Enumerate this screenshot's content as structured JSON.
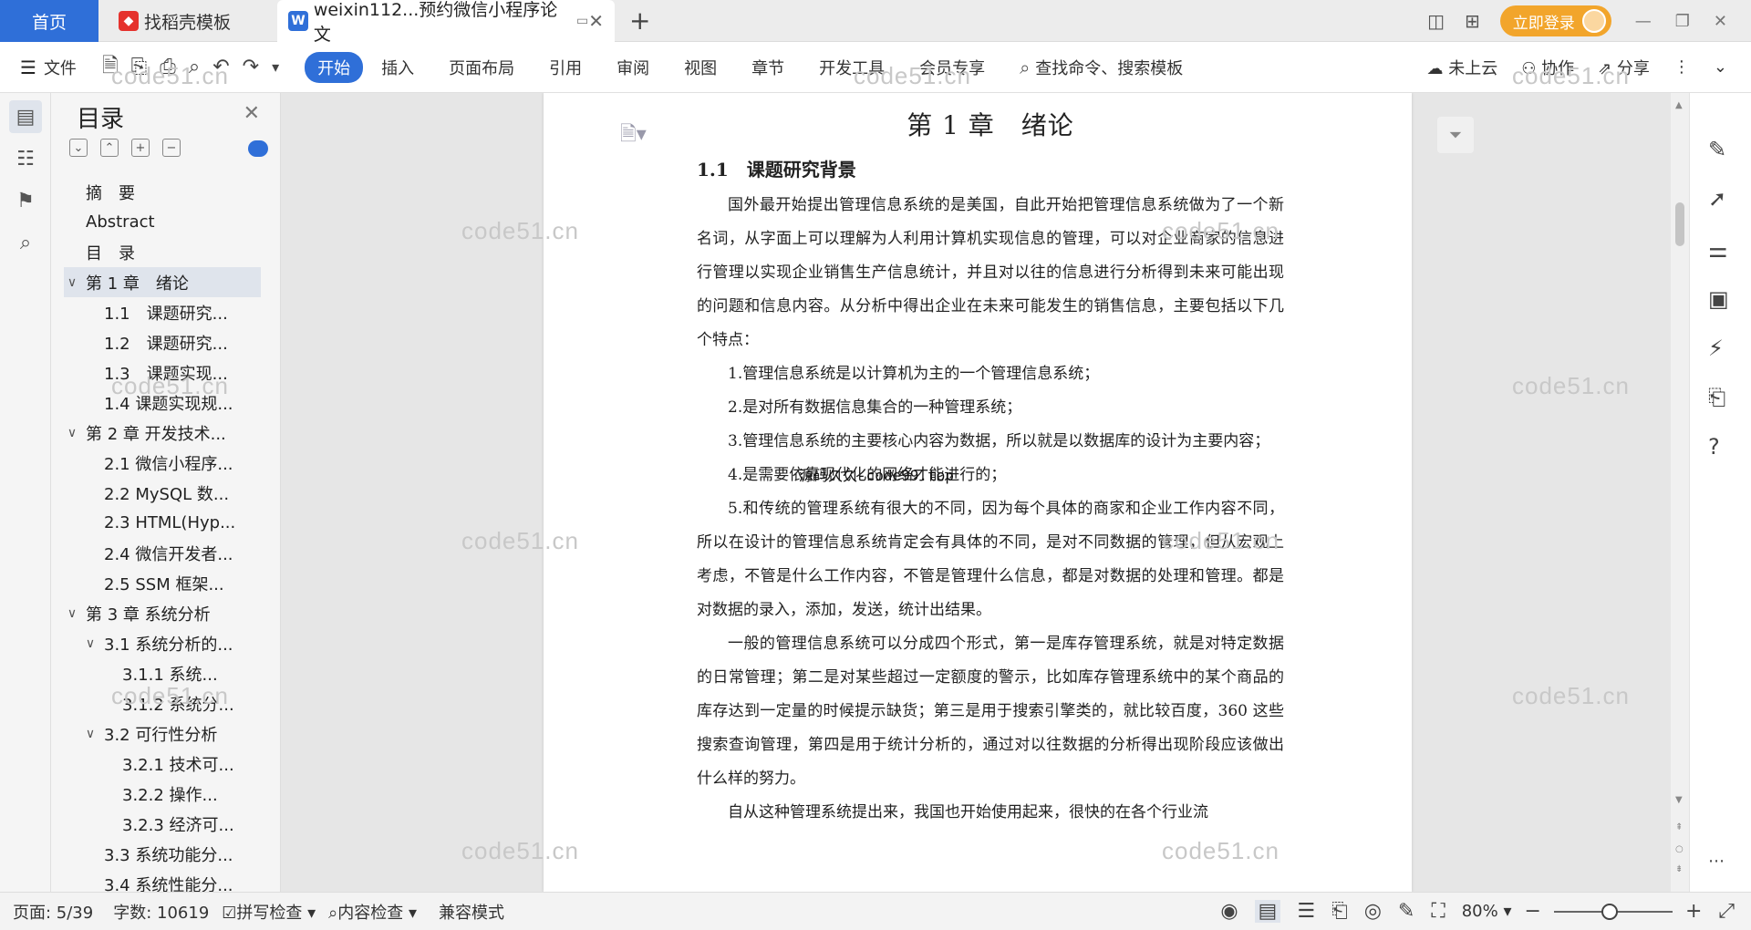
{
  "titlebar": {
    "home_tab": "首页",
    "dao_tab": "找稻壳模板",
    "doc_tab": "weixin112...预约微信小程序论文",
    "login": "立即登录"
  },
  "ribbon": {
    "file": "文件",
    "tabs": [
      "开始",
      "插入",
      "页面布局",
      "引用",
      "审阅",
      "视图",
      "章节",
      "开发工具",
      "会员专享"
    ],
    "search": "查找命令、搜索模板",
    "cloud": "未上云",
    "collab": "协作",
    "share": "分享"
  },
  "toc": {
    "title": "目录",
    "items": [
      {
        "label": "摘　要",
        "level": 0,
        "chev": ""
      },
      {
        "label": "Abstract",
        "level": 0,
        "chev": ""
      },
      {
        "label": "目　录",
        "level": 0,
        "chev": ""
      },
      {
        "label": "第 1 章　绪论",
        "level": 0,
        "chev": "∨",
        "selected": true
      },
      {
        "label": "1.1　课题研究...",
        "level": 1,
        "chev": ""
      },
      {
        "label": "1.2　课题研究...",
        "level": 1,
        "chev": ""
      },
      {
        "label": "1.3　课题实现...",
        "level": 1,
        "chev": ""
      },
      {
        "label": "1.4 课题实现规...",
        "level": 1,
        "chev": ""
      },
      {
        "label": "第 2 章 开发技术...",
        "level": 0,
        "chev": "∨"
      },
      {
        "label": "2.1 微信小程序...",
        "level": 1,
        "chev": ""
      },
      {
        "label": "2.2 MySQL 数...",
        "level": 1,
        "chev": ""
      },
      {
        "label": "2.3 HTML(Hyp...",
        "level": 1,
        "chev": ""
      },
      {
        "label": "2.4 微信开发者...",
        "level": 1,
        "chev": ""
      },
      {
        "label": "2.5 SSM 框架...",
        "level": 1,
        "chev": ""
      },
      {
        "label": "第 3 章 系统分析",
        "level": 0,
        "chev": "∨"
      },
      {
        "label": "3.1 系统分析的...",
        "level": 1,
        "chev": "∨"
      },
      {
        "label": "3.1.1 系统...",
        "level": 2,
        "chev": ""
      },
      {
        "label": "3.1.2 系统分...",
        "level": 2,
        "chev": ""
      },
      {
        "label": "3.2 可行性分析",
        "level": 1,
        "chev": "∨"
      },
      {
        "label": "3.2.1 技术可...",
        "level": 2,
        "chev": ""
      },
      {
        "label": "3.2.2 操作...",
        "level": 2,
        "chev": ""
      },
      {
        "label": "3.2.3 经济可...",
        "level": 2,
        "chev": ""
      },
      {
        "label": "3.3 系统功能分...",
        "level": 1,
        "chev": ""
      },
      {
        "label": "3.4 系统性能分...",
        "level": 1,
        "chev": ""
      }
    ]
  },
  "doc": {
    "chapter": "第 1 章　绪论",
    "section": "1.1　课题研究背景",
    "paragraphs": [
      "国外最开始提出管理信息系统的是美国，自此开始把管理信息系统做为了一个新名词，从字面上可以理解为人利用计算机实现信息的管理，可以对企业商家的信息进行管理以实现企业销售生产信息统计，并且对以往的信息进行分析得到未来可能出现的问题和信息内容。从分析中得出企业在未来可能发生的销售信息，主要包括以下几个特点：",
      "1.管理信息系统是以计算机为主的一个管理信息系统；",
      "2.是对所有数据信息集合的一种管理系统；",
      "3.管理信息系统的主要核心内容为数据，所以就是以数据库的设计为主要内容；",
      "4.是需要依靠现代化的网络才能进行的；",
      "5.和传统的管理系统有很大的不同，因为每个具体的商家和企业工作内容不同，所以在设计的管理信息系统肯定会有具体的不同，是对不同数据的管理，但从宏观上考虑，不管是什么工作内容，不管是管理什么信息，都是对数据的处理和管理。都是对数据的录入，添加，发送，统计出结果。",
      "一般的管理信息系统可以分成四个形式，第一是库存管理系统，就是对特定数据的日常管理；第二是对某些超过一定额度的警示，比如库存管理系统中的某个商品的库存达到一定量的时候提示缺货；第三是用于搜索引擎类的，就比较百度，360 这些搜索查询管理，第四是用于统计分析的，通过对以往数据的分析得出现阶段应该做出什么样的努力。",
      "自从这种管理系统提出来，我国也开始使用起来，很快的在各个行业流"
    ],
    "inline_watermark": "源码久久-code99.top",
    "watermark": "code51.cn"
  },
  "status": {
    "page": "页面: 5/39",
    "words": "字数: 10619",
    "spell": "拼写检查",
    "content_check": "内容检查",
    "compat": "兼容模式",
    "zoom": "80%",
    "zoom_level": 0.47
  }
}
